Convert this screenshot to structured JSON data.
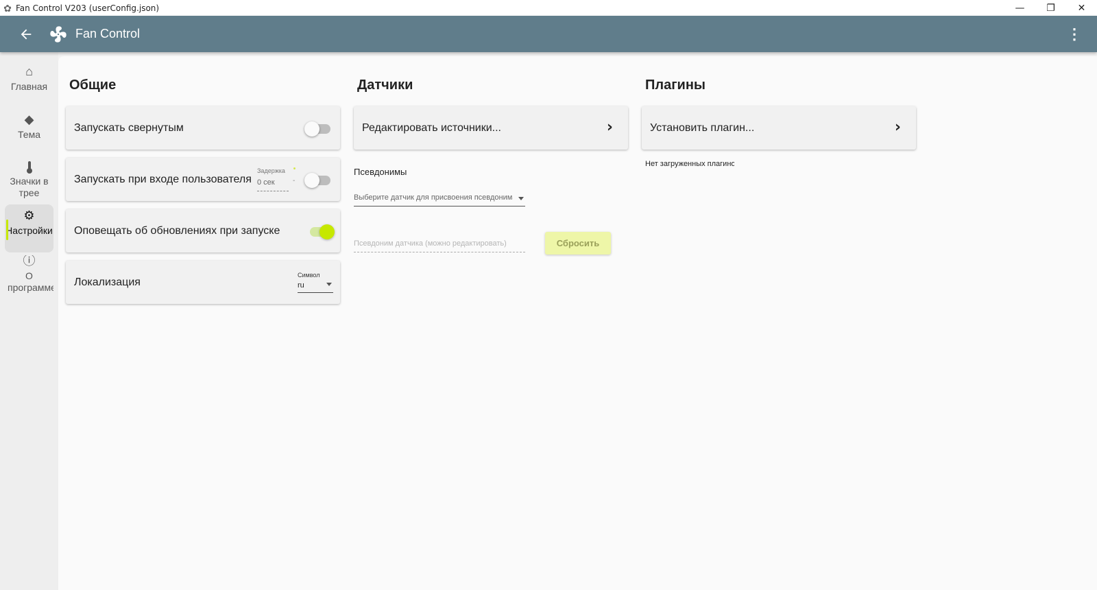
{
  "window": {
    "title": "Fan Control V203 (userConfig.json)",
    "app_icon": "fan-icon",
    "controls": {
      "minimize": "—",
      "restore": "❐",
      "close": "✕"
    }
  },
  "appbar": {
    "title": "Fan Control",
    "back_icon": "arrow-left-icon",
    "menu_icon": "more-vertical-icon",
    "background_color": "#607d8b"
  },
  "sidebar": {
    "items": [
      {
        "label": "Главная",
        "icon": "home-icon",
        "glyph": "⌂"
      },
      {
        "label": "Тема",
        "icon": "paint-bucket-icon",
        "glyph": "◆"
      },
      {
        "label": "Значки в трее",
        "icon": "thermometer-icon",
        "glyph": "🌡"
      },
      {
        "label": "Настройки",
        "icon": "gear-icon",
        "glyph": "⚙",
        "active": true
      },
      {
        "label": "О программе",
        "icon": "info-icon",
        "glyph": "ⓘ"
      }
    ],
    "accent_color": "#c6e800"
  },
  "general": {
    "title": "Общие",
    "start_minimized": {
      "label": "Запускать свернутым",
      "enabled": false
    },
    "start_on_login": {
      "label": "Запускать при входе пользователя",
      "enabled": false,
      "delay_label": "Задержка",
      "delay_value": "0 сек"
    },
    "notify_updates": {
      "label": "Оповещать об обновлениях при запуске",
      "enabled": true
    },
    "localization": {
      "label": "Локализация",
      "select_label": "Символ",
      "value": "ru"
    }
  },
  "sensors": {
    "title": "Датчики",
    "edit_sources": "Редактировать источники...",
    "aliases_heading": "Псевдонимы",
    "sensor_select_placeholder": "Выберите датчик для присвоения псевдонима",
    "alias_placeholder": "Псевдоним датчика (можно редактировать)",
    "reset_label": "Сбросить"
  },
  "plugins": {
    "title": "Плагины",
    "install": "Установить плагин...",
    "empty_note": "Нет загруженных плагинов"
  }
}
